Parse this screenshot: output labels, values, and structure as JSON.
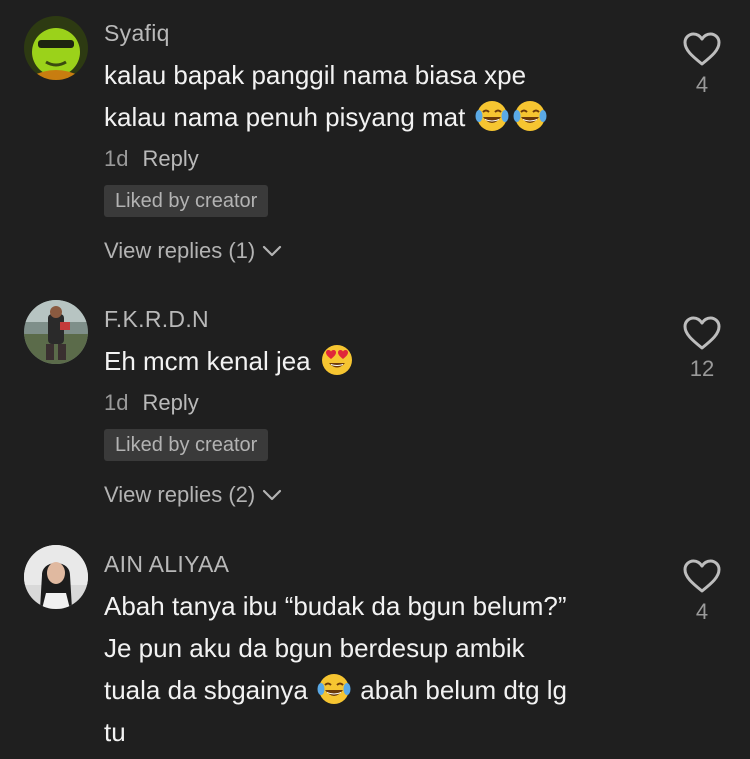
{
  "comments": [
    {
      "username": "Syafiq",
      "line1": "kalau bapak panggil nama biasa xpe",
      "line2": "kalau nama penuh pisyang mat",
      "line2_emojis": [
        "tears-of-joy-emoji",
        "tears-of-joy-emoji"
      ],
      "time": "1d",
      "reply_label": "Reply",
      "liked_label": "Liked by creator",
      "view_replies": "View replies (1)",
      "likes": "4"
    },
    {
      "username": "F.K.R.D.N",
      "line1": "Eh mcm kenal jea",
      "line1_emojis": [
        "heart-eyes-emoji"
      ],
      "time": "1d",
      "reply_label": "Reply",
      "liked_label": "Liked by creator",
      "view_replies": "View replies (2)",
      "likes": "12"
    },
    {
      "username": "AIN ALIYAA",
      "line1": "Abah tanya ibu “budak da bgun belum?”",
      "line2": "Je pun aku da bgun berdesup ambik",
      "line3_a": "tuala da sbgainya",
      "line3_emojis": [
        "tears-of-joy-emoji"
      ],
      "line3_b": "abah belum dtg lg",
      "line4": "tu",
      "likes": "4"
    }
  ],
  "icons": {
    "like": "heart-outline-icon",
    "expand": "chevron-down-icon"
  },
  "colors": {
    "background": "#1f1f1f",
    "badge": "#3a3a3a",
    "muted_text": "#9a9a9a"
  }
}
